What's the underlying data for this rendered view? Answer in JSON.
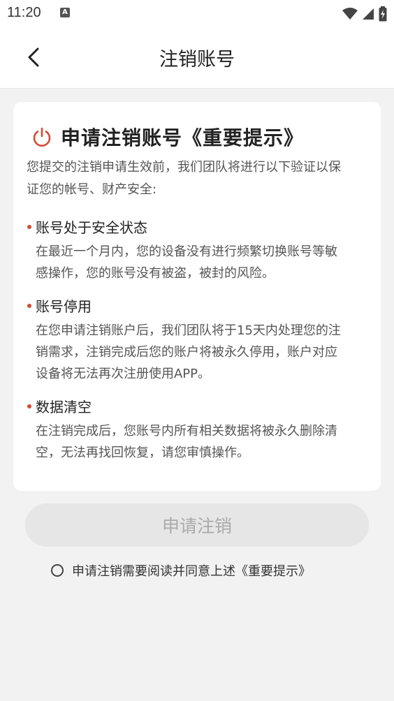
{
  "status_bar": {
    "time": "11:20",
    "a_icon_label": "A"
  },
  "nav": {
    "title": "注销账号"
  },
  "card": {
    "title": "申请注销账号《重要提示》",
    "intro_line1": "您提交的注销申请生效前，我们团队将进行以下验证以保",
    "intro_line2": "证您的帐号、财产安全:",
    "sections": [
      {
        "heading": "账号处于安全状态",
        "lines": [
          "在最近一个月内，您的设备没有进行频繁切换账号等敏",
          "感操作，您的账号没有被盗，被封的风险。"
        ]
      },
      {
        "heading": "账号停用",
        "lines": [
          "在您申请注销账户后，我们团队将于15天内处理您的注",
          "销需求，注销完成后您的账户将被永久停用，账户对应",
          "设备将无法再次注册使用APP。"
        ]
      },
      {
        "heading": "数据清空",
        "lines": [
          "在注销完成后，您账号内所有相关数据将被永久删除清",
          "空，无法再找回恢复，请您审慎操作。"
        ]
      }
    ]
  },
  "apply_button": {
    "label": "申请注销"
  },
  "agreement": {
    "text": "申请注销需要阅读并同意上述《重要提示》"
  },
  "colors": {
    "accent": "#d54a33",
    "background": "#f2f2f2",
    "disabled_button": "#e6e6e6"
  }
}
